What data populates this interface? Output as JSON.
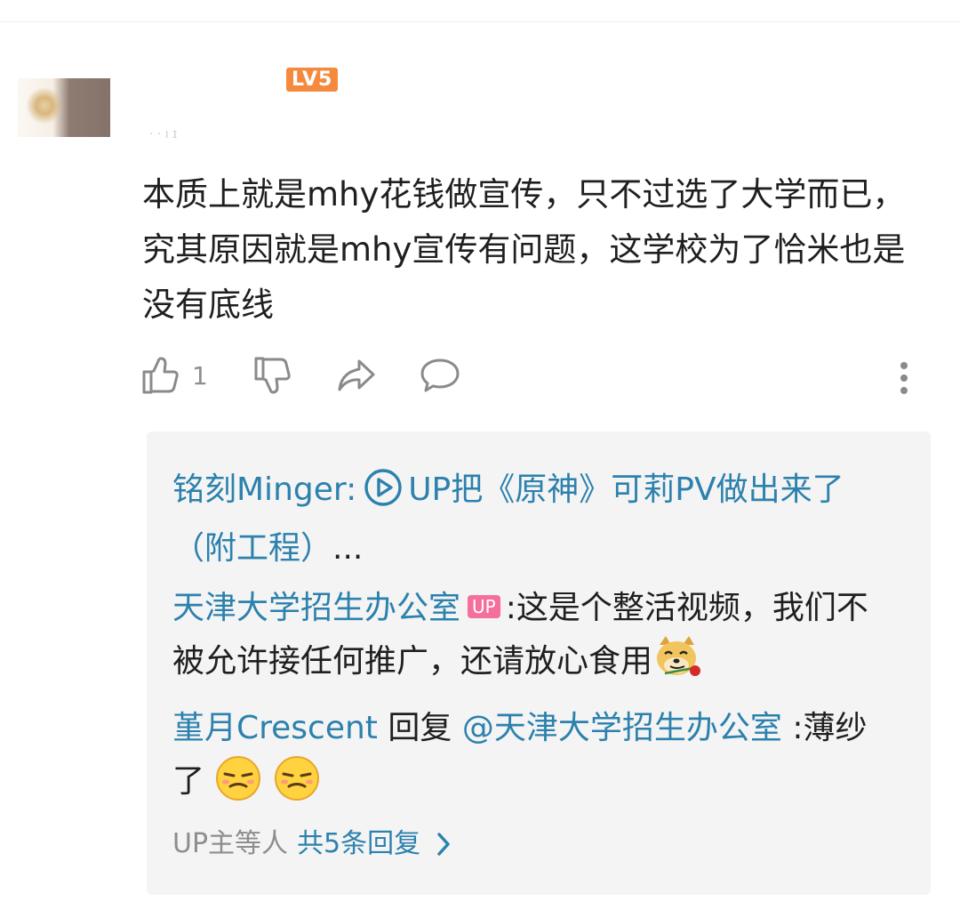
{
  "header": {
    "level_badge": "LV5",
    "meta_text": "· · ı ɪ"
  },
  "comment": {
    "text": "本质上就是mhy花钱做宣传，只不过选了大学而已，究其原因就是mhy宣传有问题，这学校为了恰米也是没有底线"
  },
  "actions": {
    "like_count": "1",
    "icons": [
      "thumb-up-icon",
      "thumb-down-icon",
      "share-icon",
      "reply-icon",
      "more-vertical-icon"
    ]
  },
  "replies": [
    {
      "author": "铭刻Minger",
      "separator": ":",
      "link_icon": "video-play-icon",
      "link_text": "UP把《原神》可莉PV做出来了（附工程）",
      "ellipsis": "..."
    },
    {
      "author": "天津大学招生办公室",
      "badge": "UP",
      "separator": ":",
      "text": "这是个整活视频，我们不被允许接任何推广，还请放心食用",
      "emoji": "doge-rose-icon"
    },
    {
      "author": "堇月Crescent",
      "reply_word": "回复",
      "mention": "@天津大学招生办公室",
      "separator": ":",
      "text": "薄纱了",
      "emojis": [
        "smirk-face-icon",
        "smirk-face-icon"
      ]
    }
  ],
  "more_replies": {
    "prefix": "UP主等人",
    "count_text": "共5条回复"
  },
  "colors": {
    "link_blue": "#2c81ad",
    "up_badge": "#f46f9b",
    "level_badge": "#f58a3f",
    "reply_bg": "#f4f4f4"
  }
}
